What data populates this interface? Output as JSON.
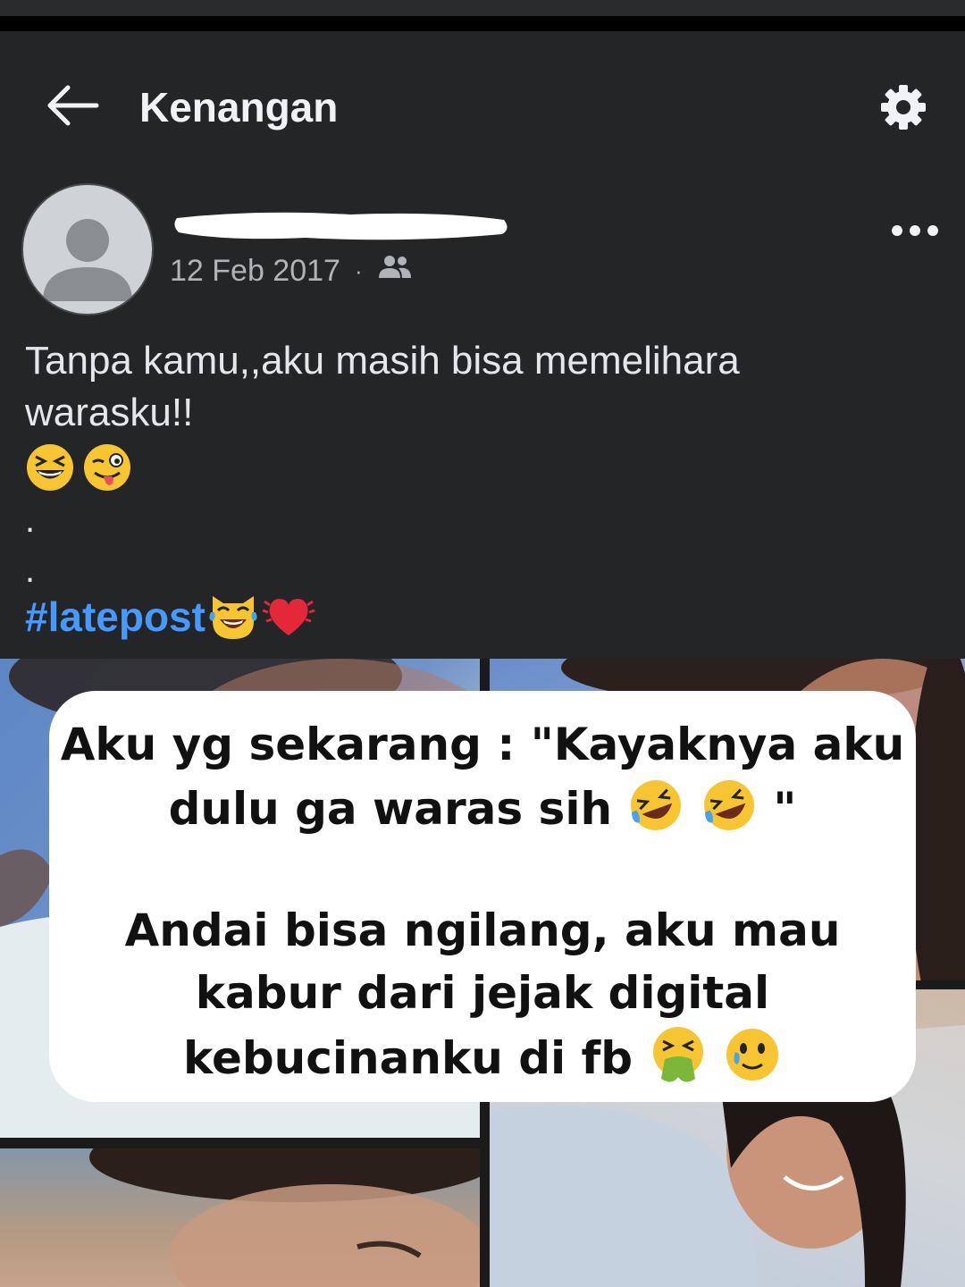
{
  "appbar": {
    "title": "Kenangan",
    "back_icon": "arrow-left-icon",
    "settings_icon": "gear-icon"
  },
  "post": {
    "author_name_redacted": true,
    "date": "12 Feb 2017",
    "separator": "·",
    "audience_icon": "friends-icon",
    "more_icon": "more-dots-icon",
    "text_line1": "Tanpa kamu,,aku masih bisa memelihara",
    "text_line2": "warasku!!",
    "emojis_line": [
      "grinning-squinting-face",
      "winking-face-tongue"
    ],
    "dot_1": ".",
    "dot_2": ".",
    "hashtag": "#latepost",
    "hashtag_emojis": [
      "cat-tears-of-joy",
      "beating-heart"
    ]
  },
  "overlay_caption": {
    "line1": "Aku yg sekarang : \"Kayaknya aku",
    "line2_text": "dulu ga waras sih",
    "line2_suffix": "\"",
    "line2_emojis": [
      "rolling-on-floor-laughing",
      "rolling-on-floor-laughing"
    ],
    "line3": "Andai bisa ngilang, aku mau",
    "line4": "kabur dari jejak digital",
    "line5_text": "kebucinanku di fb",
    "line5_emojis": [
      "vomiting-face",
      "smiling-face-with-tear"
    ]
  },
  "colors": {
    "background": "#242526",
    "hashtag": "#4599ff",
    "text": "#e4e6eb",
    "meta": "#b0b3b8"
  }
}
